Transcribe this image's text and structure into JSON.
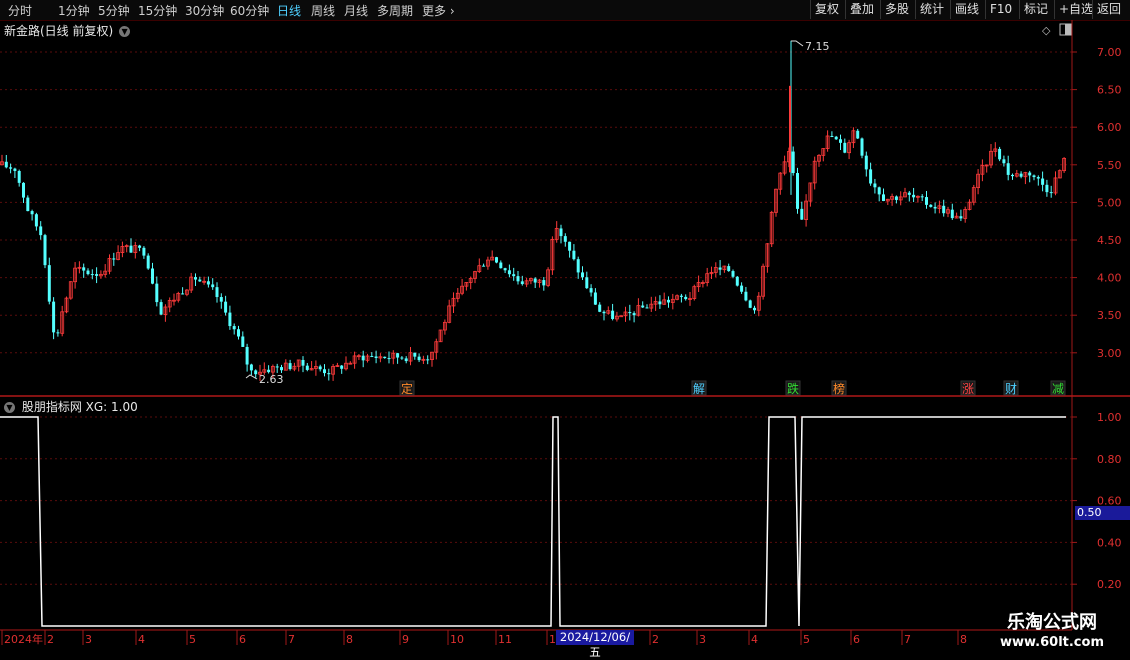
{
  "toolbar": {
    "periods": [
      "分时",
      "1分钟",
      "5分钟",
      "15分钟",
      "30分钟",
      "60分钟",
      "日线",
      "周线",
      "月线",
      "多周期",
      "更多"
    ],
    "active_period": "日线",
    "more_arrow": "›",
    "buttons": [
      "复权",
      "叠加",
      "多股",
      "统计",
      "画线",
      "F10",
      "标记",
      "+自选",
      "返回"
    ]
  },
  "main_chart": {
    "title": "新金路(日线 前复权)",
    "high_label": "7.15",
    "low_label": "2.63",
    "y_ticks": [
      "7.00",
      "6.50",
      "6.00",
      "5.50",
      "5.00",
      "4.50",
      "4.00",
      "3.50",
      "3.00"
    ],
    "events": [
      {
        "text": "定",
        "color": "#ff8a2a"
      },
      {
        "text": "解",
        "color": "#4fd0ff"
      },
      {
        "text": "跌",
        "color": "#33dd33"
      },
      {
        "text": "榜",
        "color": "#ff8a2a"
      },
      {
        "text": "涨",
        "color": "#ff4444"
      },
      {
        "text": "财",
        "color": "#4fd0ff"
      },
      {
        "text": "减",
        "color": "#33dd33"
      }
    ],
    "up_color": "#ff3b3b",
    "down_color": "#54ffff"
  },
  "indicator": {
    "title": "股朋指标网 XG: 1.00",
    "y_ticks": [
      "1.00",
      "0.80",
      "0.60",
      "0.40",
      "0.20"
    ],
    "cursor_value": "0.50"
  },
  "x_axis": {
    "labels": [
      "2024年",
      "2",
      "3",
      "4",
      "5",
      "6",
      "7",
      "8",
      "9",
      "10",
      "11",
      "1",
      "2",
      "3",
      "4",
      "5",
      "6",
      "7",
      "8"
    ],
    "highlight": "2024/12/06/五"
  },
  "chart_data": {
    "type": "line",
    "title": "",
    "series": [
      {
        "name": "XG",
        "x": [
          0,
          0.6,
          0.6,
          1,
          1,
          2,
          2,
          6
        ],
        "values": [
          1,
          1,
          0,
          0,
          1,
          1,
          0,
          1
        ]
      }
    ],
    "ylim": [
      0,
      1.05
    ]
  },
  "watermark": {
    "title": "乐淘公式网",
    "url": "www.60lt.com"
  }
}
